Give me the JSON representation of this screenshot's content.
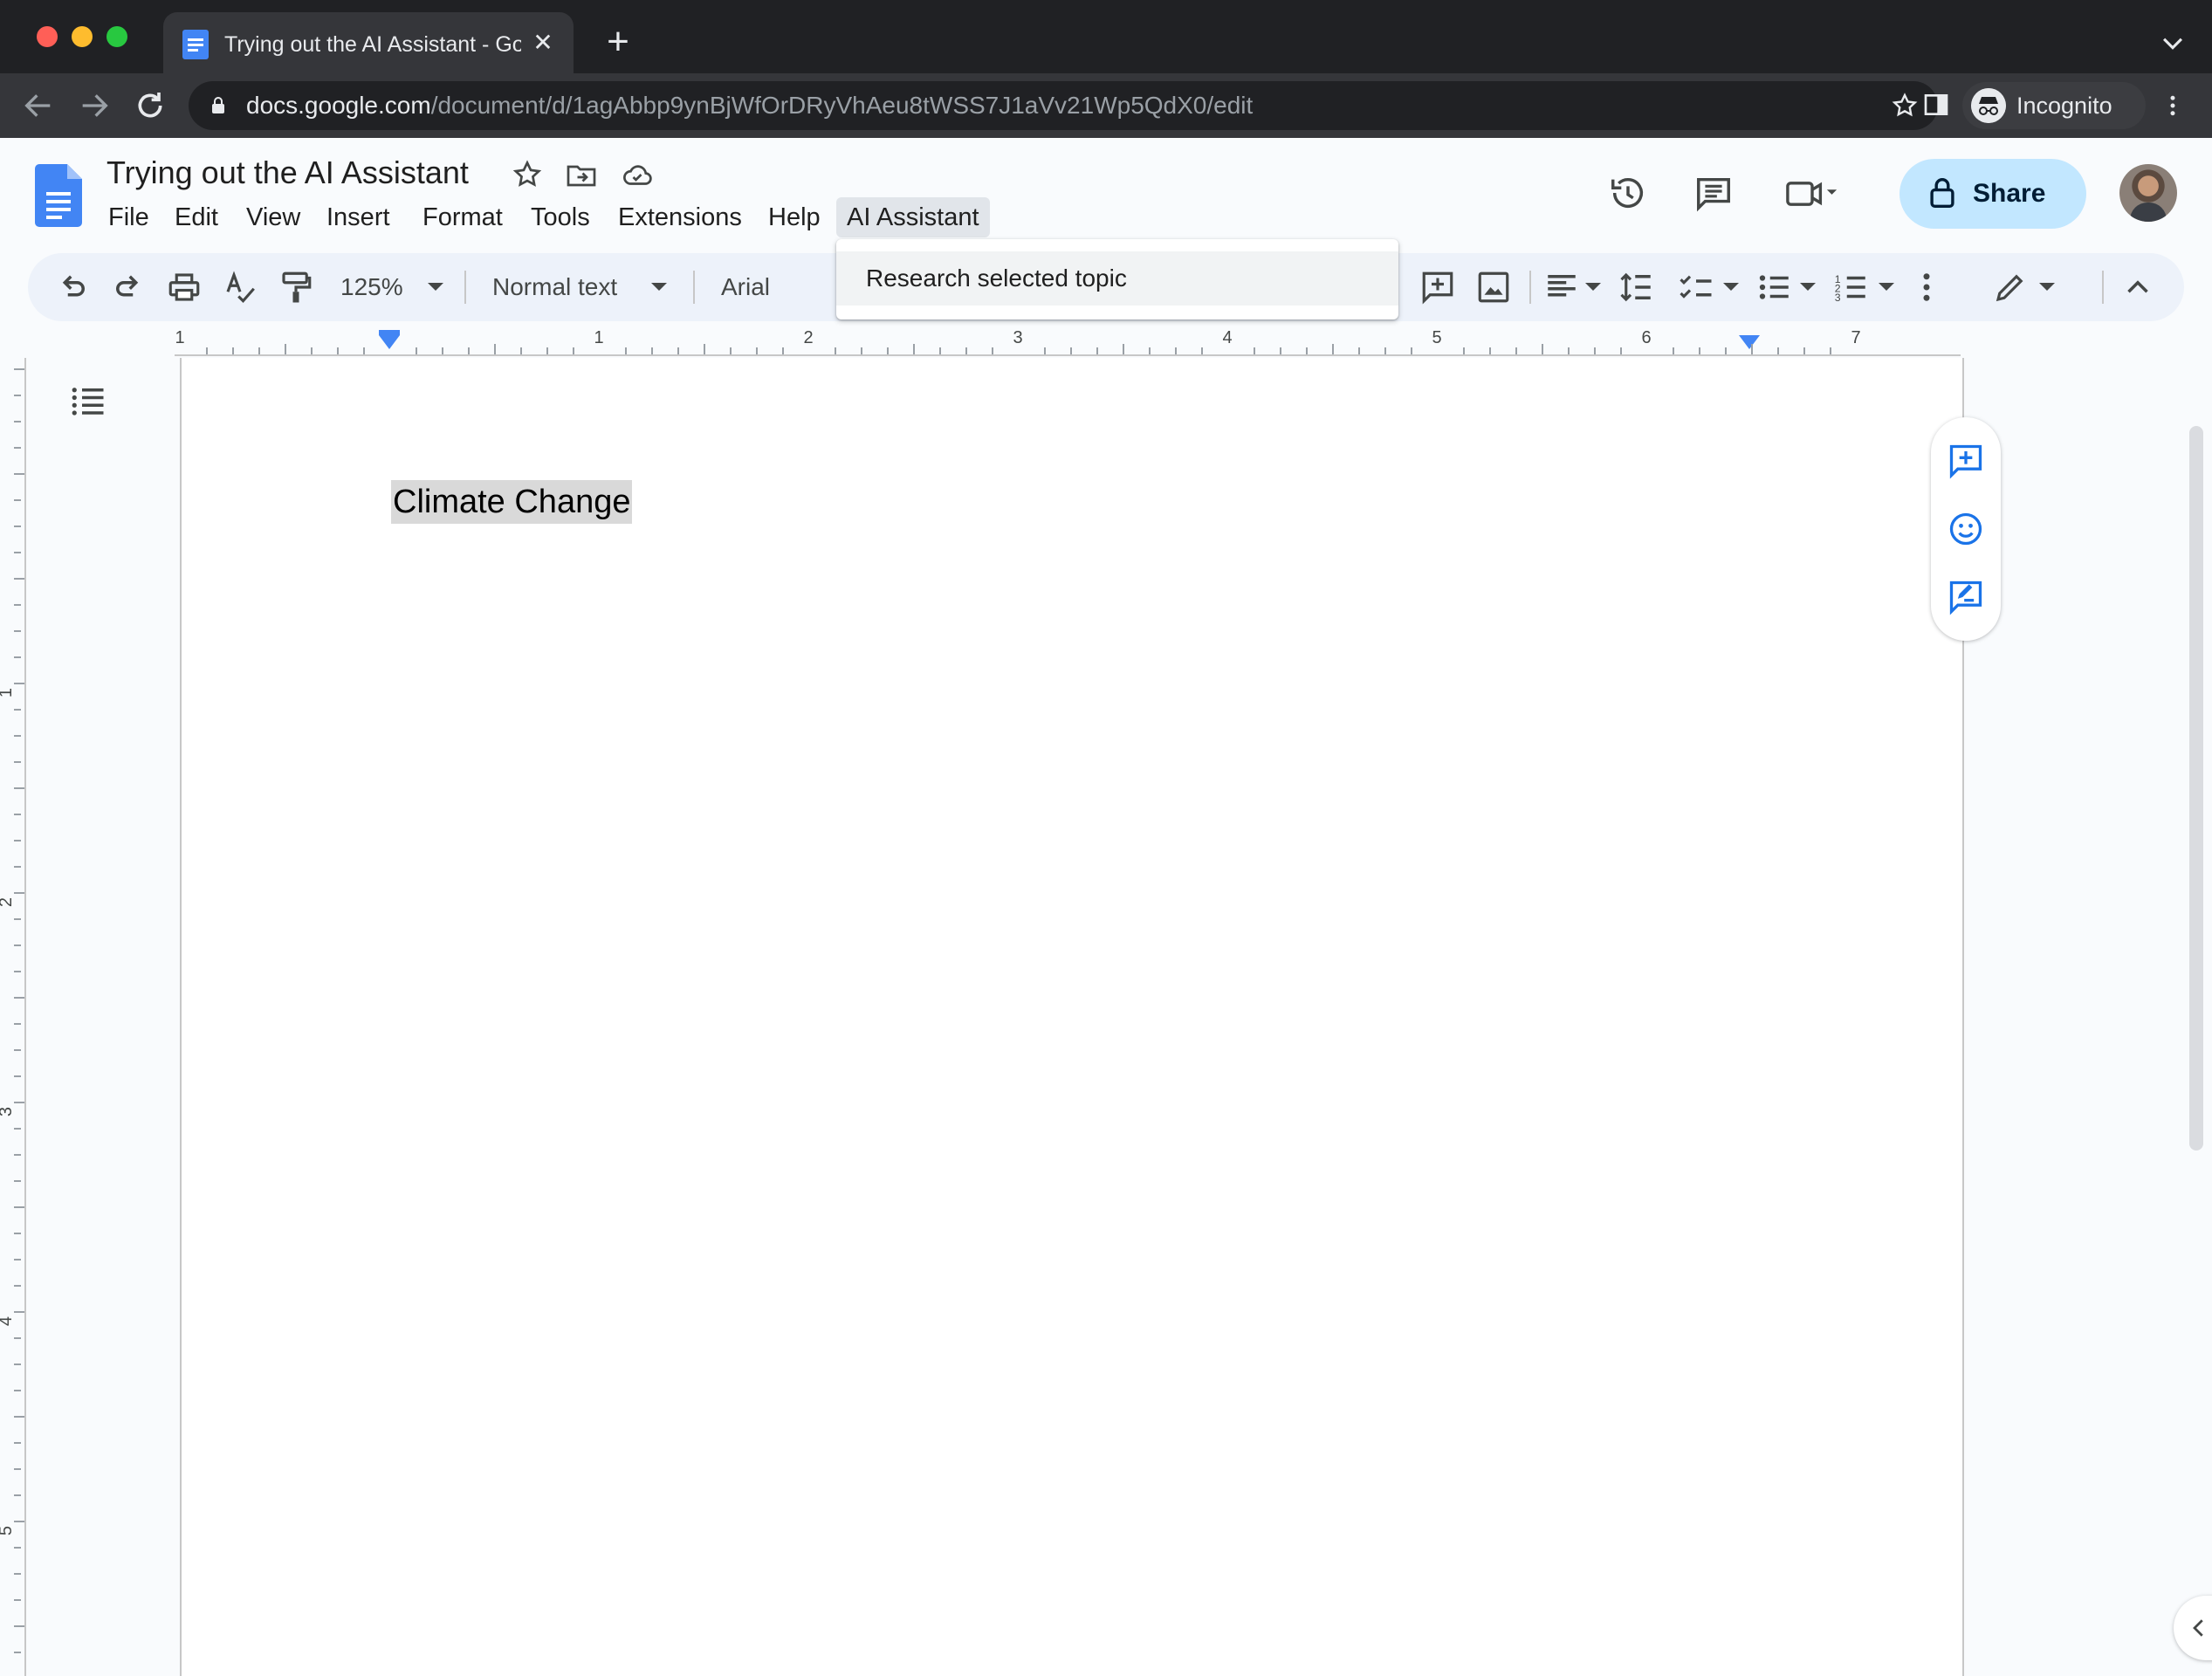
{
  "browser": {
    "tab": {
      "title": "Trying out the AI Assistant - Google Docs"
    },
    "url": {
      "host": "docs.google.com",
      "path": "/document/d/1agAbbp9ynBjWfOrDRyVhAeu8tWSS7J1aVv21Wp5QdX0/edit"
    },
    "profile": {
      "label": "Incognito"
    }
  },
  "docs": {
    "title": "Trying out the AI Assistant",
    "menus": [
      "File",
      "Edit",
      "View",
      "Insert",
      "Format",
      "Tools",
      "Extensions",
      "Help",
      "AI Assistant"
    ],
    "share_label": "Share",
    "toolbar": {
      "zoom": "125%",
      "style": "Normal text",
      "font": "Arial"
    },
    "dropdown": {
      "menu": "AI Assistant",
      "items": [
        "Research selected topic"
      ]
    },
    "ruler": {
      "numbers": [
        "1",
        "1",
        "2",
        "3",
        "4",
        "5",
        "6",
        "7"
      ],
      "vertical_numbers": [
        "1",
        "2",
        "3",
        "4",
        "5"
      ]
    },
    "body": {
      "heading": "Climate Change"
    }
  },
  "colors": {
    "share_bg": "#c2e7ff",
    "accent": "#4285f4",
    "selection": "#d9d9d9"
  },
  "icons": [
    "back-icon",
    "forward-icon",
    "reload-icon",
    "lock-icon",
    "bookmark-star-icon",
    "side-panel-icon",
    "incognito-icon",
    "kebab-menu-icon",
    "docs-logo-icon",
    "star-icon",
    "move-folder-icon",
    "cloud-saved-icon",
    "history-icon",
    "comments-icon",
    "meet-icon",
    "undo-icon",
    "redo-icon",
    "print-icon",
    "spellcheck-icon",
    "paint-format-icon",
    "insert-comment-icon",
    "insert-image-icon",
    "align-left-icon",
    "line-spacing-icon",
    "checklist-icon",
    "bulleted-list-icon",
    "numbered-list-icon",
    "more-options-icon",
    "editing-mode-pencil-icon",
    "collapse-toolbar-icon",
    "document-outline-icon",
    "add-comment-icon",
    "add-emoji-reaction-icon",
    "suggest-edits-icon"
  ]
}
